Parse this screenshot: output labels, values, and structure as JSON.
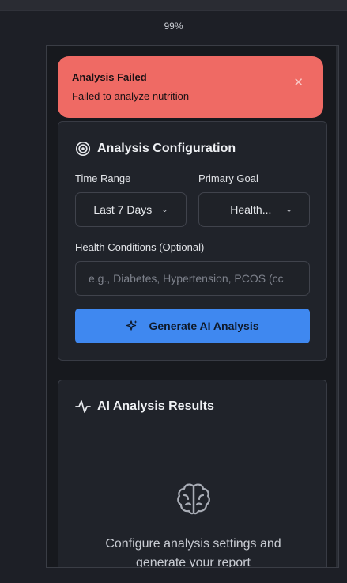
{
  "browser": {
    "zoom": "99%"
  },
  "toast": {
    "title": "Analysis Failed",
    "message": "Failed to analyze nutrition",
    "close": "✕",
    "color": "#ef6a64"
  },
  "config": {
    "title": "Analysis Configuration",
    "icon": "target-icon",
    "time_range_label": "Time Range",
    "time_range_value": "Last 7 Days",
    "goal_label": "Primary Goal",
    "goal_value": "Health...",
    "conditions_label": "Health Conditions (Optional)",
    "conditions_placeholder": "e.g., Diabetes, Hypertension, PCOS (cc",
    "generate_button": "Generate AI Analysis",
    "accent": "#3f88f0"
  },
  "results": {
    "title": "AI Analysis Results",
    "icon": "activity-icon",
    "empty_icon": "brain-icon",
    "empty_message_line1": "Configure analysis settings and",
    "empty_message_line2": "generate your report"
  }
}
